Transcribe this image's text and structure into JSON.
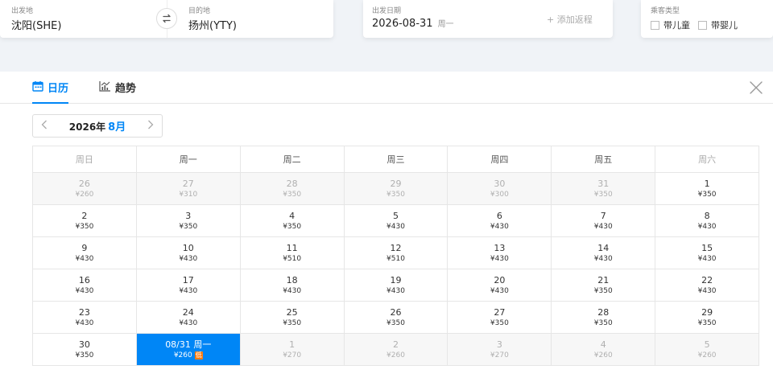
{
  "search": {
    "origin_label": "出发地",
    "origin_value": "沈阳(SHE)",
    "dest_label": "目的地",
    "dest_value": "扬州(YTY)",
    "date_label": "出发日期",
    "date_value": "2026-08-31",
    "date_weekday": "周一",
    "add_return": "+ 添加返程",
    "pax_label": "乘客类型",
    "pax_child": "带儿童",
    "pax_infant": "带婴儿"
  },
  "tabs": {
    "calendar": "日历",
    "trend": "趋势"
  },
  "month_nav": {
    "year": "2026年",
    "month": "8月"
  },
  "weekdays": [
    "周日",
    "周一",
    "周二",
    "周三",
    "周四",
    "周五",
    "周六"
  ],
  "weeks": [
    [
      {
        "num": "26",
        "price": "¥260",
        "state": "out"
      },
      {
        "num": "27",
        "price": "¥310",
        "state": "out"
      },
      {
        "num": "28",
        "price": "¥350",
        "state": "out"
      },
      {
        "num": "29",
        "price": "¥350",
        "state": "out"
      },
      {
        "num": "30",
        "price": "¥300",
        "state": "out"
      },
      {
        "num": "31",
        "price": "¥350",
        "state": "out"
      },
      {
        "num": "1",
        "price": "¥350",
        "state": "normal"
      }
    ],
    [
      {
        "num": "2",
        "price": "¥350",
        "state": "normal"
      },
      {
        "num": "3",
        "price": "¥350",
        "state": "normal"
      },
      {
        "num": "4",
        "price": "¥350",
        "state": "normal"
      },
      {
        "num": "5",
        "price": "¥430",
        "state": "normal"
      },
      {
        "num": "6",
        "price": "¥430",
        "state": "normal"
      },
      {
        "num": "7",
        "price": "¥430",
        "state": "normal"
      },
      {
        "num": "8",
        "price": "¥430",
        "state": "normal"
      }
    ],
    [
      {
        "num": "9",
        "price": "¥430",
        "state": "normal"
      },
      {
        "num": "10",
        "price": "¥430",
        "state": "normal"
      },
      {
        "num": "11",
        "price": "¥510",
        "state": "normal"
      },
      {
        "num": "12",
        "price": "¥510",
        "state": "normal"
      },
      {
        "num": "13",
        "price": "¥430",
        "state": "normal"
      },
      {
        "num": "14",
        "price": "¥430",
        "state": "normal"
      },
      {
        "num": "15",
        "price": "¥430",
        "state": "normal"
      }
    ],
    [
      {
        "num": "16",
        "price": "¥430",
        "state": "normal"
      },
      {
        "num": "17",
        "price": "¥430",
        "state": "normal"
      },
      {
        "num": "18",
        "price": "¥430",
        "state": "normal"
      },
      {
        "num": "19",
        "price": "¥430",
        "state": "normal"
      },
      {
        "num": "20",
        "price": "¥430",
        "state": "normal"
      },
      {
        "num": "21",
        "price": "¥350",
        "state": "normal"
      },
      {
        "num": "22",
        "price": "¥430",
        "state": "normal"
      }
    ],
    [
      {
        "num": "23",
        "price": "¥430",
        "state": "normal"
      },
      {
        "num": "24",
        "price": "¥430",
        "state": "normal"
      },
      {
        "num": "25",
        "price": "¥350",
        "state": "normal"
      },
      {
        "num": "26",
        "price": "¥350",
        "state": "normal"
      },
      {
        "num": "27",
        "price": "¥350",
        "state": "normal"
      },
      {
        "num": "28",
        "price": "¥350",
        "state": "normal"
      },
      {
        "num": "29",
        "price": "¥350",
        "state": "normal"
      }
    ],
    [
      {
        "num": "30",
        "price": "¥350",
        "state": "normal"
      },
      {
        "num": "08/31 周一",
        "price": "¥260",
        "state": "selected",
        "badge": "低"
      },
      {
        "num": "1",
        "price": "¥270",
        "state": "out"
      },
      {
        "num": "2",
        "price": "¥260",
        "state": "out"
      },
      {
        "num": "3",
        "price": "¥270",
        "state": "out"
      },
      {
        "num": "4",
        "price": "¥260",
        "state": "out"
      },
      {
        "num": "5",
        "price": "¥260",
        "state": "out"
      }
    ]
  ],
  "colors": {
    "accent": "#0086f6",
    "low_badge": "#ff7d13",
    "page_bg": "#f0f3f7"
  },
  "icons": {
    "swap": "swap-arrows-icon",
    "calendar": "calendar-icon",
    "trend": "trend-chart-icon",
    "close": "close-icon",
    "prev": "chevron-left-icon",
    "next": "chevron-right-icon"
  }
}
